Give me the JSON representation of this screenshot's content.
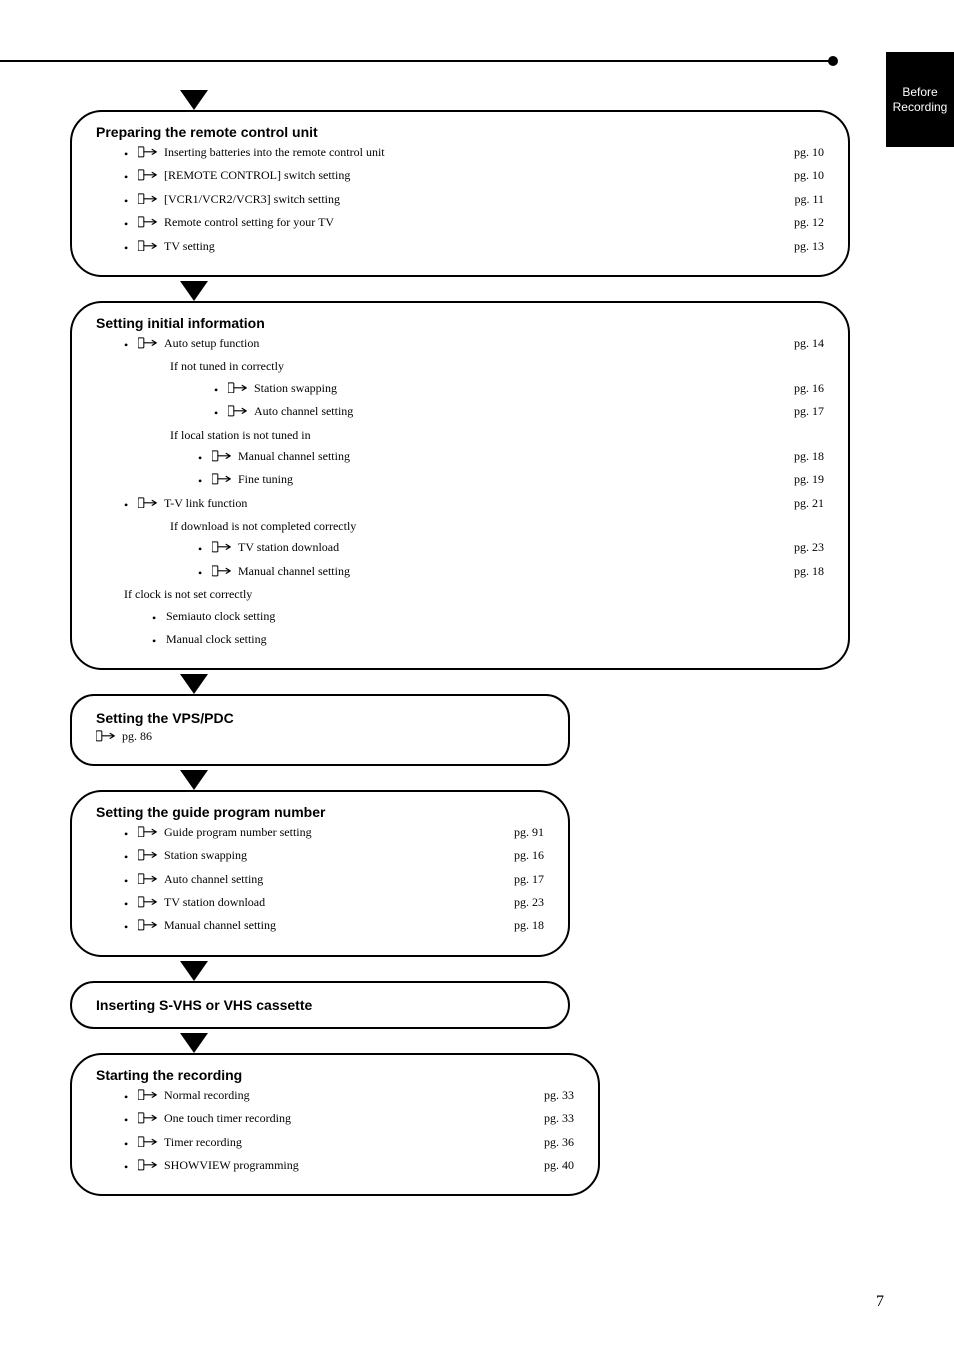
{
  "side_tab": "Before Recording",
  "page_number": "7",
  "box1": {
    "title": "Preparing the remote control unit",
    "items": [
      {
        "text": "Inserting batteries into the remote control unit",
        "page": "pg. 10"
      },
      {
        "text": "[REMOTE CONTROL] switch setting",
        "page": "pg. 10"
      },
      {
        "text": "[VCR1/VCR2/VCR3] switch setting",
        "page": "pg. 11"
      },
      {
        "text": "Remote control setting for your TV",
        "page": "pg. 12"
      },
      {
        "text": "TV setting",
        "page": "pg. 13"
      }
    ]
  },
  "box2": {
    "title": "Setting initial information",
    "lead": {
      "text": "Auto setup function",
      "page": "pg. 14"
    },
    "sub1_head": "If not tuned in correctly",
    "sub1_items": [
      {
        "text": "Station swapping",
        "page": "pg. 16"
      },
      {
        "text": "Auto channel setting",
        "page": "pg. 17"
      }
    ],
    "sub2_head": "If local station is not tuned in",
    "sub2_items": [
      {
        "text": "Manual channel setting",
        "page": "pg. 18"
      },
      {
        "text": "Fine tuning",
        "page": "pg. 19"
      }
    ],
    "second": {
      "text": "T-V link function",
      "page": "pg. 21"
    },
    "sub3_head": "If download is not completed correctly",
    "sub3_items": [
      {
        "text": "TV station download",
        "page": "pg. 23"
      },
      {
        "text": "Manual channel setting",
        "page": "pg. 18"
      }
    ],
    "note_head": "If clock is not set correctly",
    "note_items": [
      {
        "text": "Semiauto clock setting"
      },
      {
        "text": "Manual clock setting"
      }
    ]
  },
  "box3": {
    "title": "Setting the VPS/PDC",
    "page": "pg. 86"
  },
  "box4": {
    "title": "Setting the guide program number",
    "items": [
      {
        "text": "Guide program number setting",
        "page": "pg. 91"
      },
      {
        "text": "Station swapping",
        "page": "pg. 16"
      },
      {
        "text": "Auto channel setting",
        "page": "pg. 17"
      },
      {
        "text": "TV station download",
        "page": "pg. 23"
      },
      {
        "text": "Manual channel setting",
        "page": "pg. 18"
      }
    ]
  },
  "box5": {
    "title": "Inserting S-VHS or VHS cassette"
  },
  "box6": {
    "title": "Starting the recording",
    "items": [
      {
        "text": "Normal recording",
        "page": "pg. 33"
      },
      {
        "text": "One touch timer recording",
        "page": "pg. 33"
      },
      {
        "text": "Timer recording",
        "page": "pg. 36"
      },
      {
        "text": "SHOWVIEW programming",
        "page": "pg. 40"
      }
    ]
  }
}
